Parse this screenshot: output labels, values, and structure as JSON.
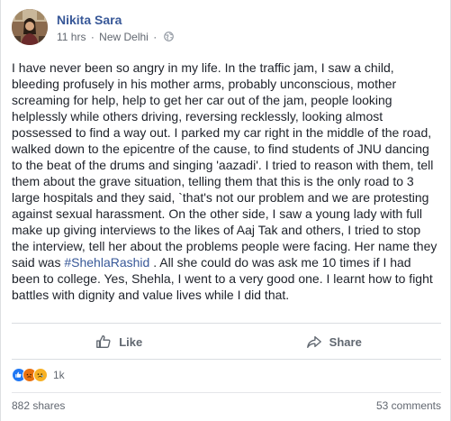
{
  "post": {
    "author": "Nikita Sara",
    "time": "11 hrs",
    "separator": "·",
    "location": "New Delhi",
    "audience_icon": "globe-icon",
    "body_part1": "I have never been so angry in my life. In the traffic jam, I saw a child, bleeding profusely in his mother arms, probably unconscious, mother screaming for help, help to get her car out of the jam, people looking helplessly while others driving, reversing recklessly, looking almost possessed to find a way out. I parked my car right in the middle of the road, walked down to the epicentre of the cause, to find students of JNU dancing to the beat of the drums and singing 'aazadi'. I tried to reason with them, tell them about the grave situation, telling them that this is the only road to 3 large hospitals and they said, `that's not our problem and we are protesting against sexual harassment. On the other side, I saw a young lady with full make up giving interviews to the likes of Aaj Tak and others, I tried to stop the interview, tell her about the problems people were facing. Her name they said was ",
    "hashtag": "#ShehlaRashid",
    "body_part2": " . All she could do was ask me 10 times if I had been to college. Yes, Shehla, I went to a very good one. I learnt how to fight battles with dignity and value lives while I did that."
  },
  "actions": {
    "like_label": "Like",
    "share_label": "Share"
  },
  "reactions": {
    "count": "1k",
    "types": [
      "like",
      "angry",
      "sad"
    ]
  },
  "footer": {
    "shares": "882 shares",
    "comments": "53 comments"
  },
  "colors": {
    "link": "#385898",
    "text": "#1d2129",
    "muted": "#616770"
  }
}
